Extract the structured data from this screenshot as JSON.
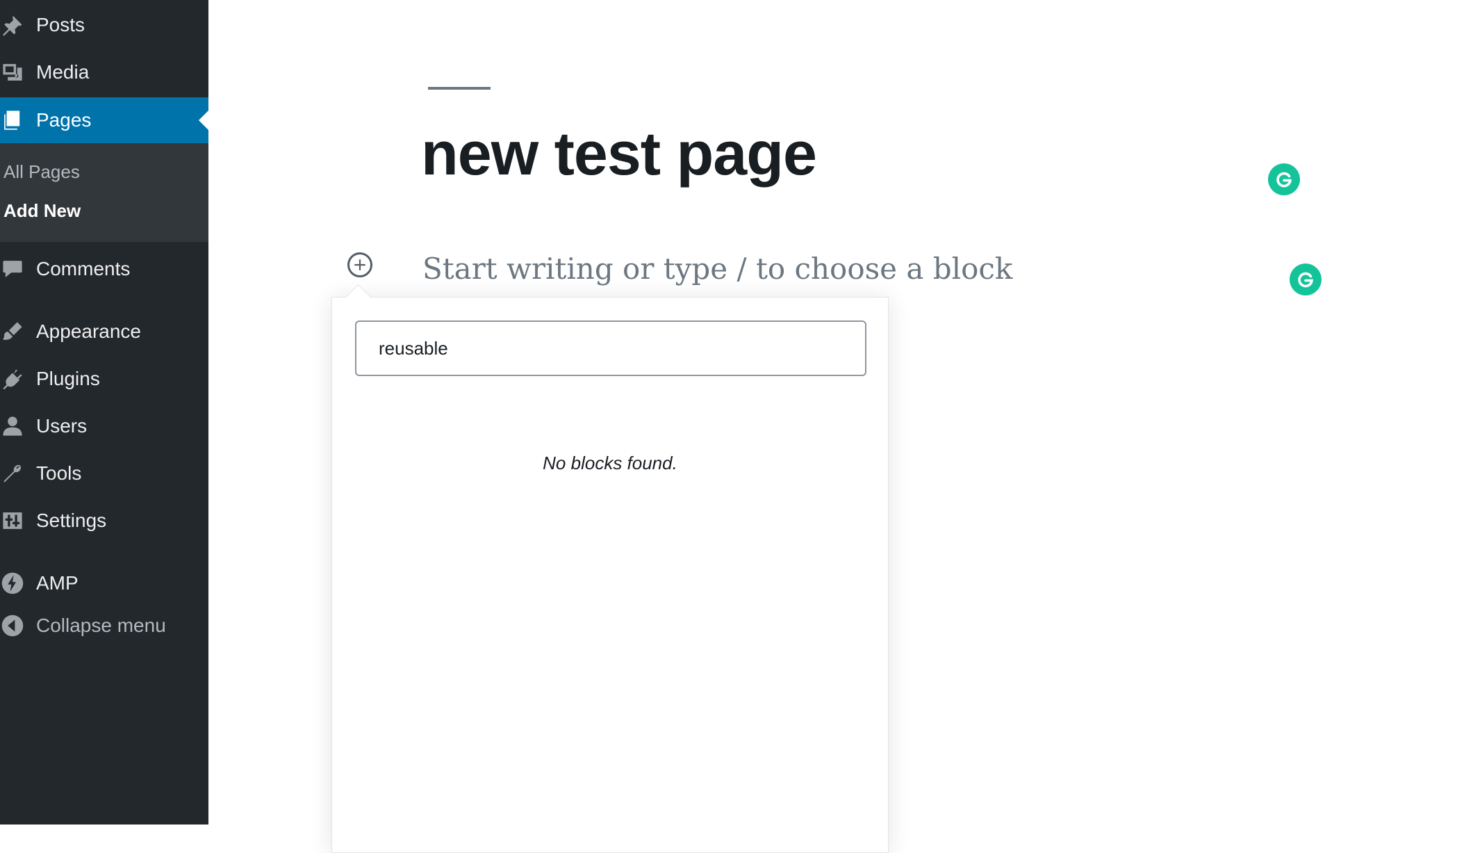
{
  "sidebar": {
    "items": [
      {
        "label": "Posts",
        "icon": "pin-icon"
      },
      {
        "label": "Media",
        "icon": "media-icon"
      },
      {
        "label": "Pages",
        "icon": "pages-icon",
        "active": true
      },
      {
        "label": "Comments",
        "icon": "comment-icon"
      },
      {
        "label": "Appearance",
        "icon": "brush-icon"
      },
      {
        "label": "Plugins",
        "icon": "plug-icon"
      },
      {
        "label": "Users",
        "icon": "user-icon"
      },
      {
        "label": "Tools",
        "icon": "wrench-icon"
      },
      {
        "label": "Settings",
        "icon": "settings-icon"
      },
      {
        "label": "AMP",
        "icon": "amp-icon"
      }
    ],
    "submenu": [
      {
        "label": "All Pages"
      },
      {
        "label": "Add New",
        "current": true
      }
    ],
    "collapse_label": "Collapse menu",
    "active_color": "#0073aa",
    "background_color": "#23282d"
  },
  "editor": {
    "title": "new test page",
    "placeholder": "Start writing or type / to choose a block"
  },
  "inserter": {
    "search_value": "reusable",
    "no_results": "No blocks found."
  },
  "grammarly_color": "#15c39a"
}
